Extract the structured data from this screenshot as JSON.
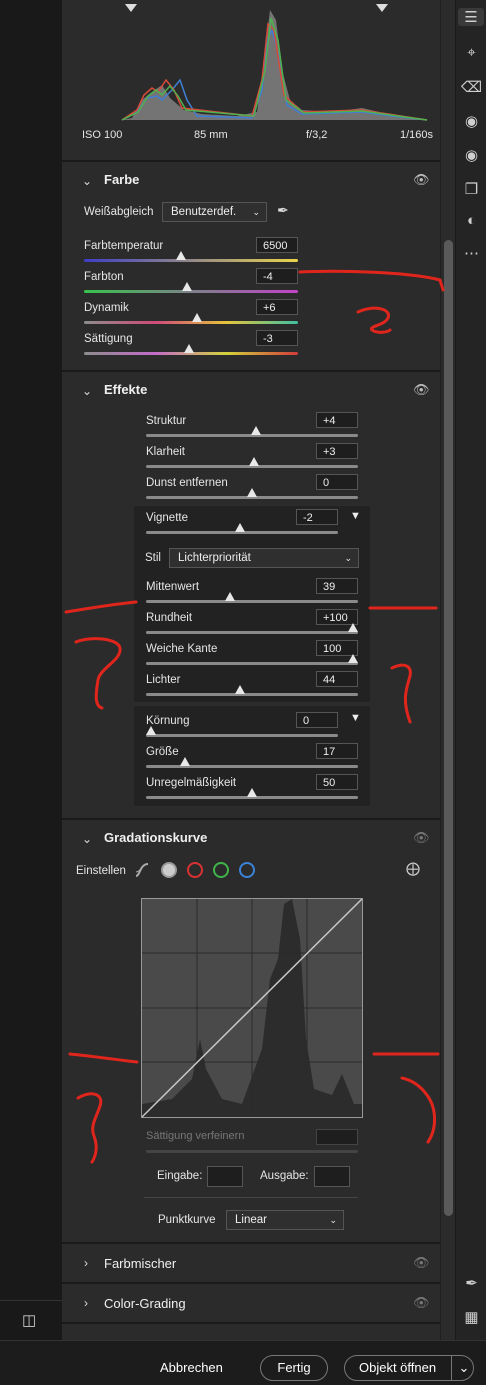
{
  "histogram": {
    "iso": "ISO 100",
    "focal": "85 mm",
    "aperture": "f/3,2",
    "shutter": "1/160s"
  },
  "farbe": {
    "title": "Farbe",
    "wb_label": "Weißabgleich",
    "wb_value": "Benutzerdef.",
    "sliders": [
      {
        "label": "Farbtemperatur",
        "value": "6500",
        "pos": 0.45
      },
      {
        "label": "Farbton",
        "value": "-4",
        "pos": 0.48
      },
      {
        "label": "Dynamik",
        "value": "+6",
        "pos": 0.53
      },
      {
        "label": "Sättigung",
        "value": "-3",
        "pos": 0.49
      }
    ]
  },
  "effekte": {
    "title": "Effekte",
    "sliders": [
      {
        "label": "Struktur",
        "value": "+4",
        "pos": 0.52
      },
      {
        "label": "Klarheit",
        "value": "+3",
        "pos": 0.51
      },
      {
        "label": "Dunst entfernen",
        "value": "0",
        "pos": 0.5
      }
    ],
    "vignette": {
      "label": "Vignette",
      "value": "-2",
      "pos": 0.49
    },
    "stil_label": "Stil",
    "stil_value": "Lichterpriorität",
    "vig_sliders": [
      {
        "label": "Mittenwert",
        "value": "39",
        "pos": 0.39
      },
      {
        "label": "Rundheit",
        "value": "+100",
        "pos": 1.0
      },
      {
        "label": "Weiche Kante",
        "value": "100",
        "pos": 1.0
      },
      {
        "label": "Lichter",
        "value": "44",
        "pos": 0.44
      }
    ],
    "koernung": {
      "label": "Körnung",
      "value": "0",
      "pos": 0.0
    },
    "korn_sliders": [
      {
        "label": "Größe",
        "value": "17",
        "pos": 0.17
      },
      {
        "label": "Unregelmäßigkeit",
        "value": "50",
        "pos": 0.5
      }
    ]
  },
  "gradation": {
    "title": "Gradationskurve",
    "einstellen": "Einstellen",
    "saett_label": "Sättigung verfeinern",
    "eingabe": "Eingabe:",
    "ausgabe": "Ausgabe:",
    "punktkurve": "Punktkurve",
    "punkt_value": "Linear"
  },
  "farbmischer": "Farbmischer",
  "colorgrading": "Color-Grading",
  "footer": {
    "cancel": "Abbrechen",
    "done": "Fertig",
    "open": "Objekt öffnen"
  },
  "colors": {
    "accent_red": "#e0261c",
    "panel": "#2b2b2b"
  },
  "icons": {
    "right": [
      "sliders-icon",
      "crop-icon",
      "eraser-icon",
      "mask-icon",
      "redeye-icon",
      "presets-icon",
      "snapshot-icon",
      "more-icon",
      "eyedropper-icon",
      "grid-icon"
    ]
  }
}
